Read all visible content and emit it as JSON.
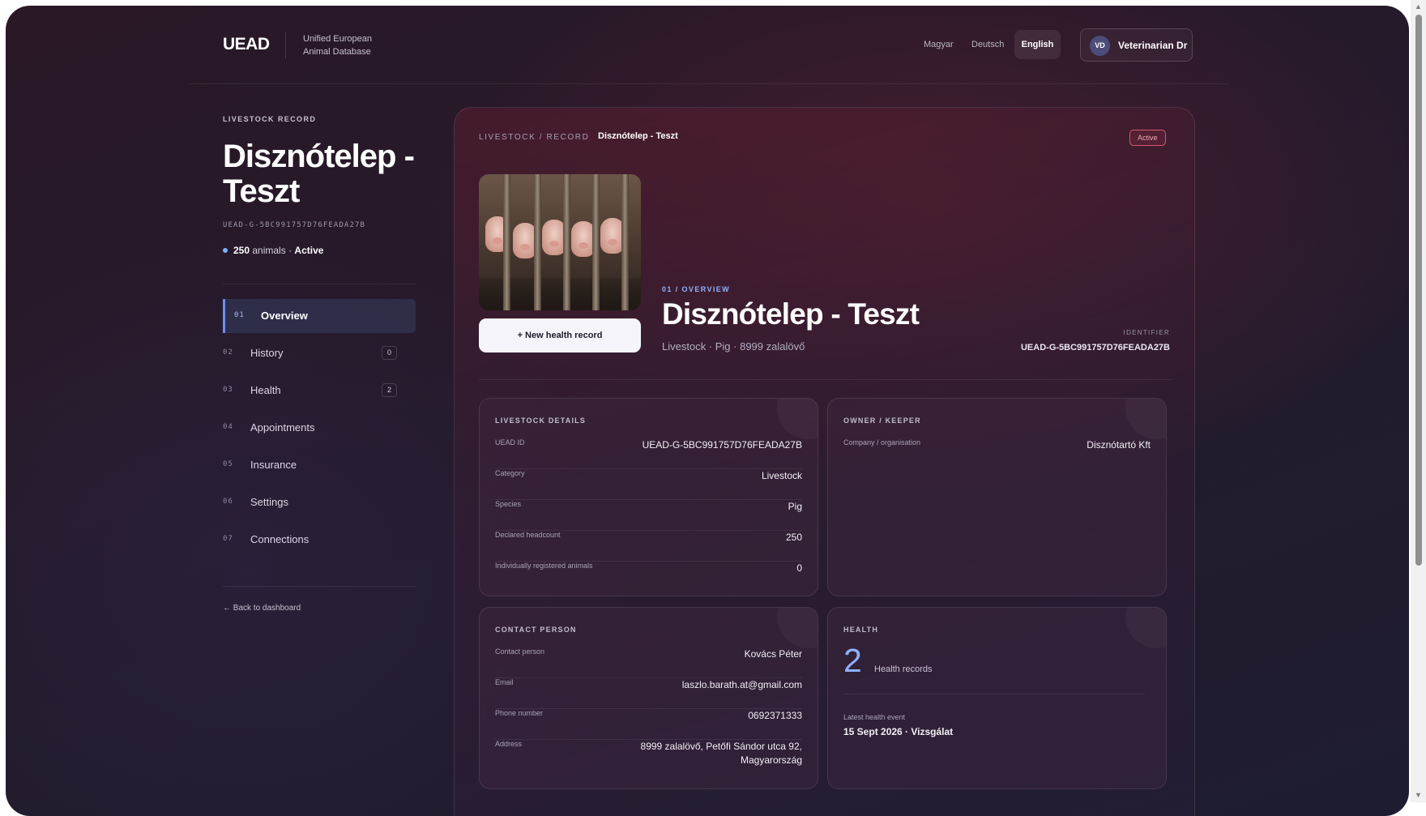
{
  "header": {
    "logo": "UEAD",
    "tagline_line1": "Unified European",
    "tagline_line2": "Animal Database",
    "languages": [
      "Magyar",
      "Deutsch",
      "English"
    ],
    "active_language": "English",
    "user_initials": "VD",
    "user_name": "Veterinarian Dr"
  },
  "sidebar": {
    "eyebrow": "LIVESTOCK RECORD",
    "title": "Disznótelep - Teszt",
    "record_id": "UEAD-G-5BC991757D76FEADA27B",
    "status_count": "250",
    "status_unit": "animals",
    "status_sep": "·",
    "status_value": "Active",
    "items": [
      {
        "num": "01",
        "label": "Overview",
        "badge": ""
      },
      {
        "num": "02",
        "label": "History",
        "badge": "0"
      },
      {
        "num": "03",
        "label": "Health",
        "badge": "2"
      },
      {
        "num": "04",
        "label": "Appointments",
        "badge": ""
      },
      {
        "num": "05",
        "label": "Insurance",
        "badge": ""
      },
      {
        "num": "06",
        "label": "Settings",
        "badge": ""
      },
      {
        "num": "07",
        "label": "Connections",
        "badge": ""
      }
    ],
    "back_link": "← Back to dashboard"
  },
  "main": {
    "breadcrumb": "LIVESTOCK / RECORD",
    "breadcrumb_current": "Disznótelep - Teszt",
    "status_badge": "Active",
    "new_health_button": "+ New health record",
    "overview_eyebrow": "01 / OVERVIEW",
    "overview_title": "Disznótelep - Teszt",
    "overview_subtitle": "Livestock · Pig · 8999 zalalövő",
    "identifier_label": "IDENTIFIER",
    "identifier_value": "UEAD-G-5BC991757D76FEADA27B"
  },
  "livestock_details": {
    "title": "LIVESTOCK DETAILS",
    "rows": [
      {
        "label": "UEAD ID",
        "value": "UEAD-G-5BC991757D76FEADA27B"
      },
      {
        "label": "Category",
        "value": "Livestock"
      },
      {
        "label": "Species",
        "value": "Pig"
      },
      {
        "label": "Declared headcount",
        "value": "250"
      },
      {
        "label": "Individually registered animals",
        "value": "0"
      }
    ]
  },
  "owner": {
    "title": "OWNER / KEEPER",
    "rows": [
      {
        "label": "Company / organisation",
        "value": "Disznótartó Kft"
      }
    ]
  },
  "contact": {
    "title": "CONTACT PERSON",
    "rows": [
      {
        "label": "Contact person",
        "value": "Kovács Péter"
      },
      {
        "label": "Email",
        "value": "laszlo.barath.at@gmail.com"
      },
      {
        "label": "Phone number",
        "value": "0692371333"
      },
      {
        "label": "Address",
        "value_line1": "8999 zalalövő, Petőfi Sándor utca 92,",
        "value_line2": "Magyarország"
      }
    ]
  },
  "health": {
    "title": "HEALTH",
    "count": "2",
    "count_label": "Health records",
    "latest_label": "Latest health event",
    "latest_value": "15 Sept 2026 · Vizsgálat"
  }
}
